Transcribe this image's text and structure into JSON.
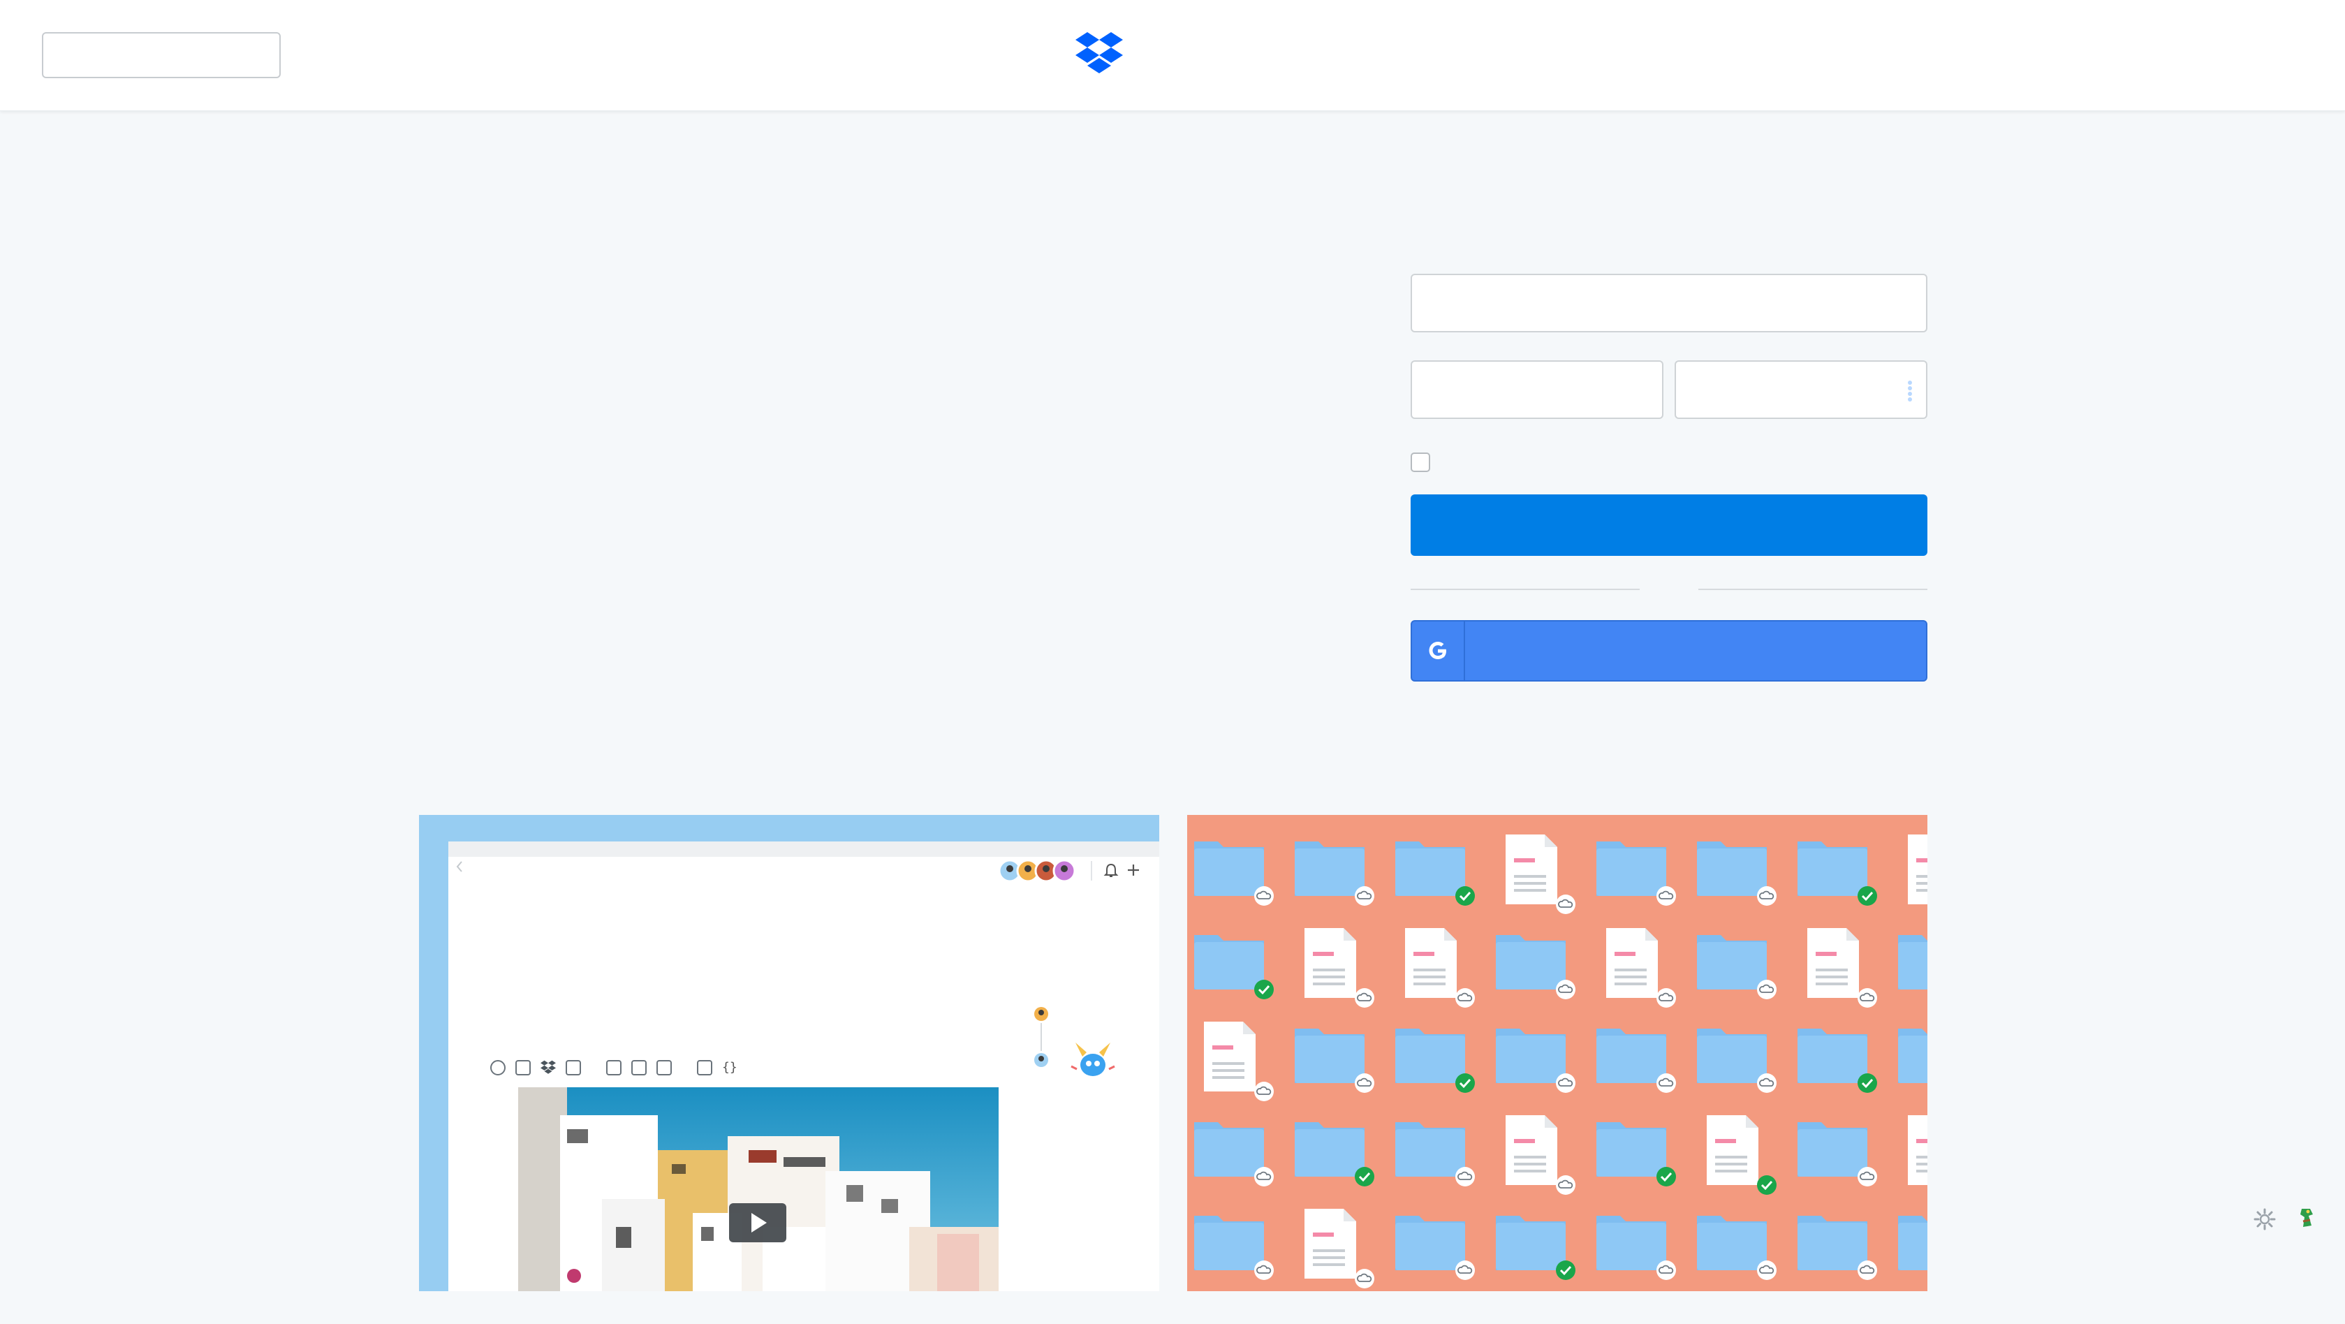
{
  "header": {
    "logo_icon": "dropbox-logo-icon",
    "top_left_box": ""
  },
  "form": {
    "email_value": "",
    "first_name_value": "",
    "password_value": "",
    "remember_checked": false,
    "primary_button_label": "",
    "divider_text": "",
    "google_button_label": "",
    "google_icon": "google-g-icon"
  },
  "panels": {
    "left": {
      "name": "paper-doc-preview"
    },
    "right": {
      "name": "folders-illustration"
    }
  },
  "colors": {
    "primary": "#007ee5",
    "google": "#4285f4",
    "left_panel_bg": "#97cdf2",
    "right_panel_bg": "#f39a7f",
    "folder": "#8ec8f5",
    "check": "#1aa64a"
  },
  "footer_icons": [
    "settings-gear-icon",
    "feedback-mascot-icon"
  ]
}
